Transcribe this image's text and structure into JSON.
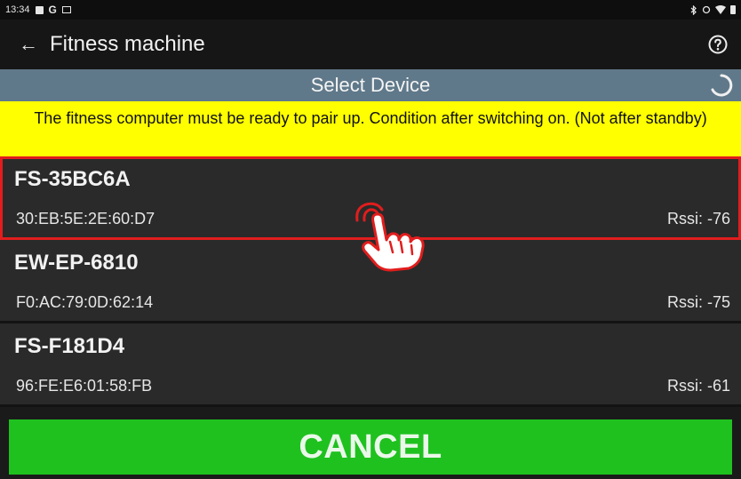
{
  "status_bar": {
    "time": "13:34",
    "left_icons": [
      "notification-square-icon",
      "google-g-icon",
      "screen-icon"
    ],
    "right_icons": [
      "bluetooth-icon",
      "data-icon",
      "wifi-icon",
      "battery-icon"
    ],
    "g_glyph": "G"
  },
  "app_bar": {
    "back_glyph": "←",
    "title": "Fitness machine",
    "help_icon": "help-circle-icon"
  },
  "select_header": {
    "title": "Select Device",
    "spinner_icon": "loading-spinner-icon"
  },
  "warning": {
    "text": "The fitness computer must be ready to pair up. Condition after switching on. (Not after standby)"
  },
  "devices": [
    {
      "name": "FS-35BC6A",
      "mac": "30:EB:5E:2E:60:D7",
      "rssi": "Rssi: -76",
      "highlighted": true
    },
    {
      "name": "EW-EP-6810",
      "mac": "F0:AC:79:0D:62:14",
      "rssi": "Rssi: -75",
      "highlighted": false
    },
    {
      "name": "FS-F181D4",
      "mac": "96:FE:E6:01:58:FB",
      "rssi": "Rssi: -61",
      "highlighted": false
    }
  ],
  "cancel_button": {
    "label": "CANCEL",
    "color": "#1fc11f"
  },
  "colors": {
    "header": "#60798a",
    "warning": "#ffff00",
    "highlight": "#e11d1d"
  }
}
